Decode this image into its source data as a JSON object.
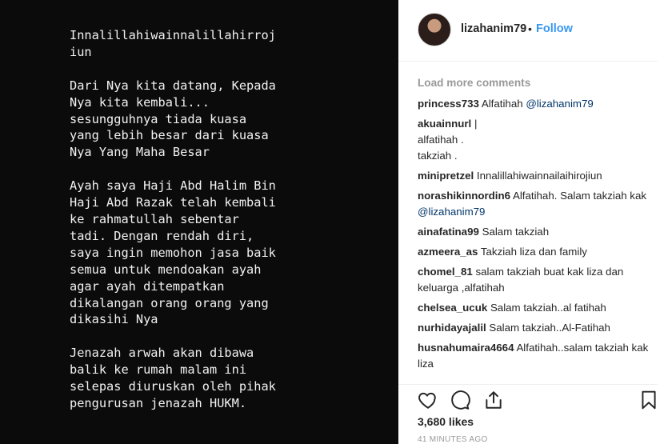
{
  "post": {
    "media_text_lines": [
      "Innalillahiwainnalillahirroj",
      "iun",
      "",
      "Dari Nya kita datang, Kepada",
      "Nya kita kembali...",
      "sesungguhnya tiada kuasa",
      "yang lebih besar dari kuasa",
      "Nya Yang Maha Besar",
      "",
      "Ayah saya Haji Abd Halim Bin",
      "Haji Abd Razak telah kembali",
      "ke rahmatullah sebentar",
      "tadi. Dengan rendah diri,",
      "saya ingin memohon jasa baik",
      "semua untuk mendoakan ayah",
      "agar ayah ditempatkan",
      "dikalangan orang orang yang",
      "dikasihi Nya",
      "",
      "Jenazah arwah akan dibawa",
      "balik ke rumah malam ini",
      "selepas diuruskan oleh pihak",
      "pengurusan jenazah HUKM."
    ]
  },
  "header": {
    "username": "lizahanim79",
    "separator": "•",
    "follow_label": "Follow"
  },
  "comments": {
    "load_more_label": "Load more comments",
    "items": [
      {
        "user": "princess733",
        "text": "Alfatihah ",
        "mention": "@lizahanim79"
      },
      {
        "user": "akuainnurl",
        "text": "|",
        "extra_lines": [
          "alfatihah .",
          "takziah ."
        ]
      },
      {
        "user": "minipretzel",
        "text": "Innalillahiwainnailaihirojiun"
      },
      {
        "user": "norashikinnordin6",
        "text": "Alfatihah. Salam takziah kak ",
        "mention": "@lizahanim79"
      },
      {
        "user": "ainafatina99",
        "text": "Salam takziah"
      },
      {
        "user": "azmeera_as",
        "text": "Takziah liza dan family"
      },
      {
        "user": "chomel_81",
        "text": "salam takziah buat kak liza dan keluarga ,alfatihah"
      },
      {
        "user": "chelsea_ucuk",
        "text": "Salam takziah..al fatihah"
      },
      {
        "user": "nurhidayajalil",
        "text": "Salam takziah..Al-Fatihah"
      },
      {
        "user": "husnahumaira4664",
        "text": "Alfatihah..salam takziah kak liza"
      }
    ]
  },
  "actions": {
    "icons": [
      "heart-icon",
      "comment-icon",
      "share-icon",
      "bookmark-icon"
    ]
  },
  "likes_label": "3,680 likes",
  "timestamp": "41 MINUTES AGO"
}
